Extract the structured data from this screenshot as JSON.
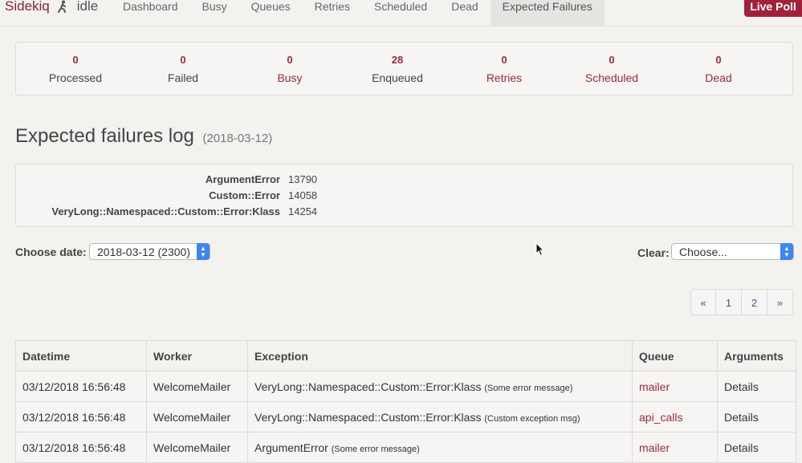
{
  "brand": {
    "name": "Sidekiq",
    "status": "idle"
  },
  "nav": {
    "items": [
      {
        "label": "Dashboard"
      },
      {
        "label": "Busy"
      },
      {
        "label": "Queues"
      },
      {
        "label": "Retries"
      },
      {
        "label": "Scheduled"
      },
      {
        "label": "Dead"
      },
      {
        "label": "Expected Failures",
        "active": true
      }
    ],
    "live_poll_label": "Live Poll"
  },
  "summary": [
    {
      "value": "0",
      "label": "Processed"
    },
    {
      "value": "0",
      "label": "Failed"
    },
    {
      "value": "0",
      "label": "Busy"
    },
    {
      "value": "28",
      "label": "Enqueued"
    },
    {
      "value": "0",
      "label": "Retries"
    },
    {
      "value": "0",
      "label": "Scheduled"
    },
    {
      "value": "0",
      "label": "Dead"
    }
  ],
  "heading": {
    "title": "Expected failures log",
    "date": "(2018-03-12)"
  },
  "counts": [
    {
      "name": "ArgumentError",
      "count": "13790"
    },
    {
      "name": "Custom::Error",
      "count": "14058"
    },
    {
      "name": "VeryLong::Namespaced::Custom::Error:Klass",
      "count": "14254"
    }
  ],
  "filters": {
    "choose_date_label": "Choose date:",
    "date_value": "2018-03-12 (2300)",
    "clear_label": "Clear:",
    "clear_value": "Choose..."
  },
  "pagination": [
    "«",
    "1",
    "2",
    "»"
  ],
  "table": {
    "headers": [
      "Datetime",
      "Worker",
      "Exception",
      "Queue",
      "Arguments"
    ],
    "rows": [
      {
        "datetime": "03/12/2018 16:56:48",
        "worker": "WelcomeMailer",
        "exception": "VeryLong::Namespaced::Custom::Error:Klass",
        "message": "(Some error message)",
        "queue": "mailer",
        "args": "Details"
      },
      {
        "datetime": "03/12/2018 16:56:48",
        "worker": "WelcomeMailer",
        "exception": "VeryLong::Namespaced::Custom::Error:Klass",
        "message": "(Custom exception msg)",
        "queue": "api_calls",
        "args": "Details"
      },
      {
        "datetime": "03/12/2018 16:56:48",
        "worker": "WelcomeMailer",
        "exception": "ArgumentError",
        "message": "(Some error message)",
        "queue": "mailer",
        "args": "Details"
      }
    ]
  },
  "colors": {
    "brand": "#8a2435",
    "live_poll": "#a1213a",
    "link": "#9b2a3e",
    "select_arrows": "#3b86f2"
  },
  "icons": {
    "status": "running-person-icon",
    "cursor": "mouse-pointer-icon"
  }
}
